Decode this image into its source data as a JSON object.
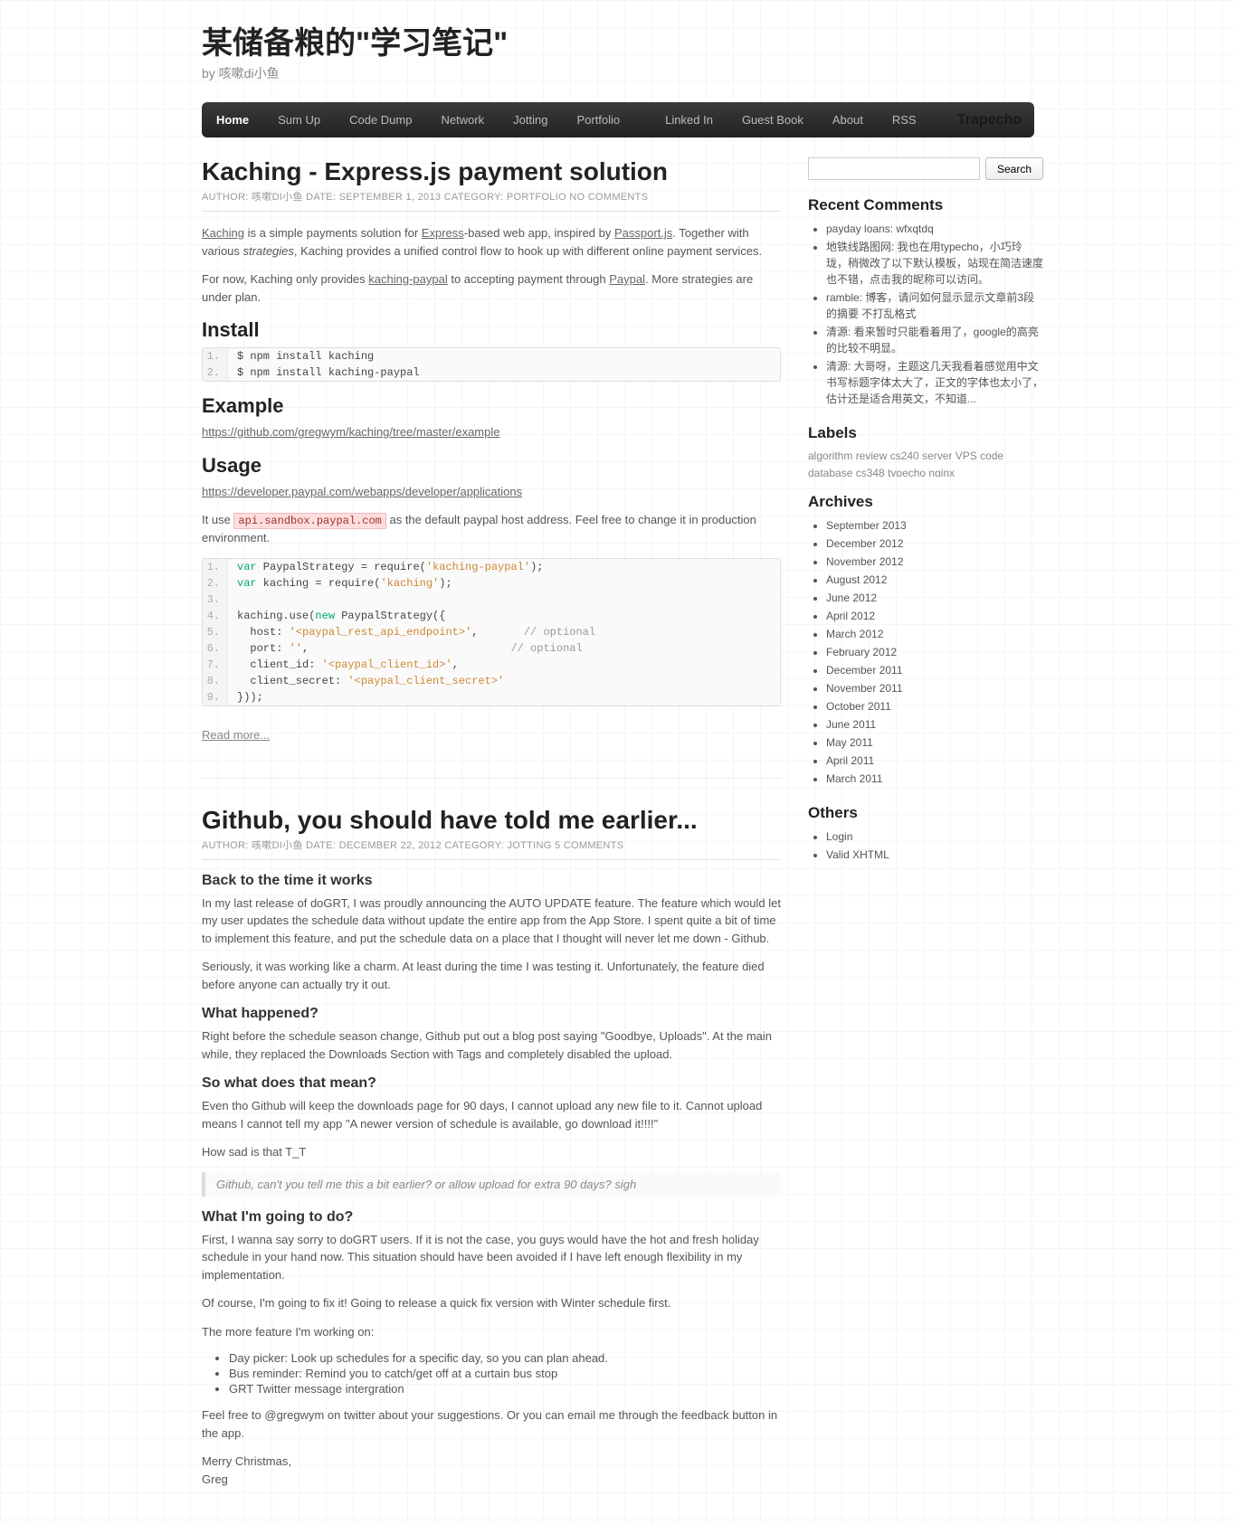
{
  "header": {
    "title": "某储备粮的\"学习笔记\"",
    "tagline": "by 咳嗽di小鱼"
  },
  "nav": {
    "items": [
      "Home",
      "Sum Up",
      "Code Dump",
      "Network",
      "Jotting",
      "Portfolio"
    ],
    "items2": [
      "Linked In",
      "Guest Book",
      "About",
      "RSS"
    ],
    "brand": "Trapecho"
  },
  "search": {
    "placeholder": "",
    "button": "Search"
  },
  "post1": {
    "title": "Kaching - Express.js payment solution",
    "meta": {
      "authorLabel": "AUTHOR: ",
      "author": "咳嗽DI小鱼",
      "dateLabel": " DATE: ",
      "date": "SEPTEMBER 1, 2013",
      "catLabel": " CATEGORY: ",
      "cat": "PORTFOLIO",
      "comments": " NO COMMENTS"
    },
    "p1a": "Kaching",
    "p1b": " is a simple payments solution for ",
    "p1c": "Express",
    "p1d": "-based web app, inspired by ",
    "p1e": "Passport.js",
    "p1f": ". Together with various ",
    "p1g": "strategies",
    "p1h": ", Kaching provides a unified control flow to hook up with different online payment services.",
    "p2a": "For now, Kaching only provides ",
    "p2b": "kaching-paypal",
    "p2c": " to accepting payment through ",
    "p2d": "Paypal",
    "p2e": ". More strategies are under plan.",
    "h_install": "Install",
    "code1": [
      "$ npm install kaching",
      "$ npm install kaching-paypal"
    ],
    "h_example": "Example",
    "example_url": "https://github.com/gregwym/kaching/tree/master/example",
    "h_usage": "Usage",
    "usage_url": "https://developer.paypal.com/webapps/developer/applications",
    "p3a": "It use ",
    "p3b": "api.sandbox.paypal.com",
    "p3c": " as the default paypal host address. Feel free to change it in production environment.",
    "readmore": "Read more..."
  },
  "post2": {
    "title": "Github, you should have told me earlier...",
    "meta": {
      "authorLabel": "AUTHOR: ",
      "author": "咳嗽DI小鱼",
      "dateLabel": " DATE: ",
      "date": "DECEMBER 22, 2012",
      "catLabel": " CATEGORY: ",
      "cat": "JOTTING",
      "comments": " 5 COMMENTS"
    },
    "h1": "Back to the time it works",
    "p1": "In my last release of doGRT, I was proudly announcing the AUTO UPDATE feature. The feature which would let my user updates the schedule data without update the entire app from the App Store. I spent quite a bit of time to implement this feature, and put the schedule data on a place that I thought will never let me down - Github.",
    "p2": "Seriously, it was working like a charm. At least during the time I was testing it. Unfortunately, the feature died before anyone can actually try it out.",
    "h2": "What happened?",
    "p3": "Right before the schedule season change, Github put out a blog post saying \"Goodbye, Uploads\". At the main while, they replaced the Downloads Section with Tags and completely disabled the upload.",
    "h3": "So what does that mean?",
    "p4": "Even tho Github will keep the downloads page for 90 days, I cannot upload any new file to it. Cannot upload means I cannot tell my app \"A newer version of schedule is available, go download it!!!!\"",
    "p5": "How sad is that T_T",
    "quote": "Github, can't you tell me this a bit earlier? or allow upload for extra 90 days? sigh",
    "h4": "What I'm going to do?",
    "p6": "First, I wanna say sorry to doGRT users. If it is not the case, you guys would have the hot and fresh holiday schedule in your hand now. This situation should have been avoided if I have left enough flexibility in my implementation.",
    "p7": "Of course, I'm going to fix it! Going to release a quick fix version with Winter schedule first.",
    "p8": "The more feature I'm working on:",
    "features": [
      "Day picker: Look up schedules for a specific day, so you can plan ahead.",
      "Bus reminder: Remind you to catch/get off at a curtain bus stop",
      "GRT Twitter message intergration"
    ],
    "p9": "Feel free to @gregwym on twitter about your suggestions. Or you can email me through the feedback button in the app.",
    "p10": "Merry Christmas,",
    "p11": "Greg"
  },
  "sidebar": {
    "recent_h": "Recent Comments",
    "recent": [
      "payday loans: wfxqtdq",
      "地铁线路图网: 我也在用typecho，小巧玲珑，稍微改了以下默认模板，站现在简洁速度也不错，点击我的昵称可以访问。",
      "ramble: 博客，请问如何显示显示文章前3段的摘要 不打乱格式",
      "清源: 看来暂时只能看着用了，google的高亮的比较不明显。",
      "清源: 大哥呀，主题这几天我看着感觉用中文书写标题字体太大了，正文的字体也太小了，估计还是适合用英文，不知道..."
    ],
    "labels_h": "Labels",
    "labels": "algorithm review cs240 server VPS code database cs348 typecho nginx",
    "archives_h": "Archives",
    "archives": [
      "September 2013",
      "December 2012",
      "November 2012",
      "August 2012",
      "June 2012",
      "April 2012",
      "March 2012",
      "February 2012",
      "December 2011",
      "November 2011",
      "October 2011",
      "June 2011",
      "May 2011",
      "April 2011",
      "March 2011"
    ],
    "others_h": "Others",
    "others": [
      "Login",
      "Valid XHTML"
    ]
  }
}
